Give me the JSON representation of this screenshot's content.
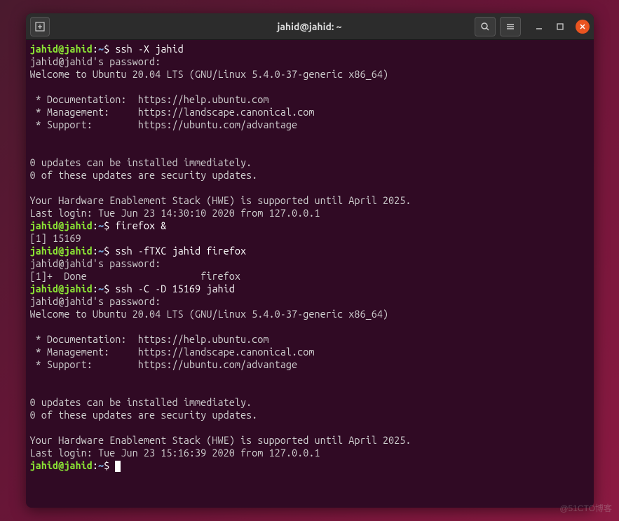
{
  "window": {
    "title": "jahid@jahid: ~"
  },
  "prompt": {
    "user_host": "jahid@jahid",
    "path": "~",
    "symbol": "$"
  },
  "session": [
    {
      "type": "cmd",
      "command": "ssh -X jahid"
    },
    {
      "type": "out",
      "text": "jahid@jahid's password:"
    },
    {
      "type": "out",
      "text": "Welcome to Ubuntu 20.04 LTS (GNU/Linux 5.4.0-37-generic x86_64)"
    },
    {
      "type": "out",
      "text": ""
    },
    {
      "type": "out",
      "text": " * Documentation:  https://help.ubuntu.com"
    },
    {
      "type": "out",
      "text": " * Management:     https://landscape.canonical.com"
    },
    {
      "type": "out",
      "text": " * Support:        https://ubuntu.com/advantage"
    },
    {
      "type": "out",
      "text": ""
    },
    {
      "type": "out",
      "text": ""
    },
    {
      "type": "out",
      "text": "0 updates can be installed immediately."
    },
    {
      "type": "out",
      "text": "0 of these updates are security updates."
    },
    {
      "type": "out",
      "text": ""
    },
    {
      "type": "out",
      "text": "Your Hardware Enablement Stack (HWE) is supported until April 2025."
    },
    {
      "type": "out",
      "text": "Last login: Tue Jun 23 14:30:10 2020 from 127.0.0.1"
    },
    {
      "type": "cmd",
      "command": "firefox &"
    },
    {
      "type": "out",
      "text": "[1] 15169"
    },
    {
      "type": "cmd",
      "command": "ssh -fTXC jahid firefox"
    },
    {
      "type": "out",
      "text": "jahid@jahid's password:"
    },
    {
      "type": "out",
      "text": "[1]+  Done                    firefox"
    },
    {
      "type": "cmd",
      "command": "ssh -C -D 15169 jahid"
    },
    {
      "type": "out",
      "text": "jahid@jahid's password:"
    },
    {
      "type": "out",
      "text": "Welcome to Ubuntu 20.04 LTS (GNU/Linux 5.4.0-37-generic x86_64)"
    },
    {
      "type": "out",
      "text": ""
    },
    {
      "type": "out",
      "text": " * Documentation:  https://help.ubuntu.com"
    },
    {
      "type": "out",
      "text": " * Management:     https://landscape.canonical.com"
    },
    {
      "type": "out",
      "text": " * Support:        https://ubuntu.com/advantage"
    },
    {
      "type": "out",
      "text": ""
    },
    {
      "type": "out",
      "text": ""
    },
    {
      "type": "out",
      "text": "0 updates can be installed immediately."
    },
    {
      "type": "out",
      "text": "0 of these updates are security updates."
    },
    {
      "type": "out",
      "text": ""
    },
    {
      "type": "out",
      "text": "Your Hardware Enablement Stack (HWE) is supported until April 2025."
    },
    {
      "type": "out",
      "text": "Last login: Tue Jun 23 15:16:39 2020 from 127.0.0.1"
    },
    {
      "type": "cmd",
      "command": "",
      "cursor": true
    }
  ],
  "watermark": "@51CTO博客"
}
